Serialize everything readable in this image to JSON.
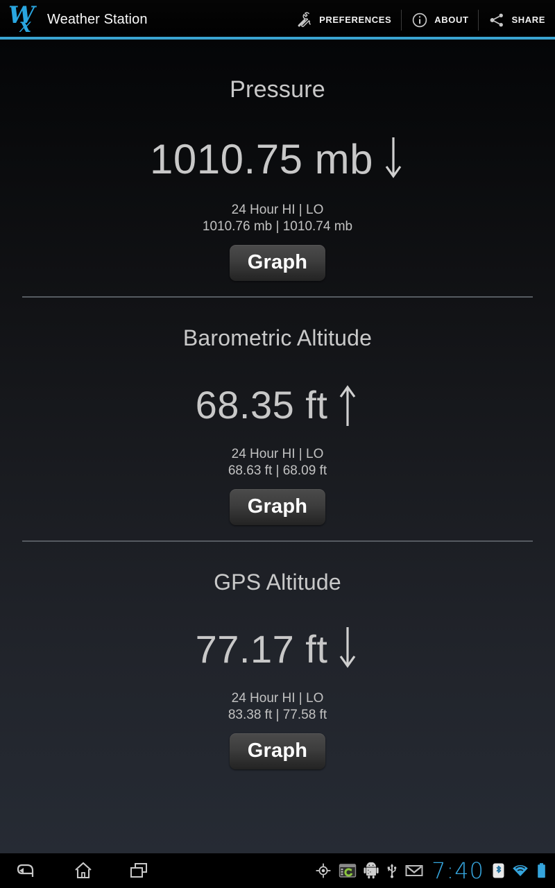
{
  "app": {
    "title": "Weather Station",
    "logo_icon": "wx-logo-icon",
    "accent_color": "#3aa3d0"
  },
  "actionbar": {
    "items": [
      {
        "label": "PREFERENCES",
        "icon": "wrench-icon"
      },
      {
        "label": "ABOUT",
        "icon": "info-circle-icon"
      },
      {
        "label": "SHARE",
        "icon": "share-icon"
      }
    ]
  },
  "sections": [
    {
      "title": "Pressure",
      "value": "1010.75 mb",
      "trend": "down",
      "trend_icon": "arrow-down-icon",
      "hilo_label": "24 Hour HI | LO",
      "hilo_values": "1010.76 mb | 1010.74 mb",
      "graph_label": "Graph"
    },
    {
      "title": "Barometric Altitude",
      "value": "68.35 ft",
      "trend": "up",
      "trend_icon": "arrow-up-icon",
      "hilo_label": "24 Hour HI | LO",
      "hilo_values": "68.63 ft | 68.09 ft",
      "graph_label": "Graph"
    },
    {
      "title": "GPS Altitude",
      "value": "77.17 ft",
      "trend": "down",
      "trend_icon": "arrow-down-icon",
      "hilo_label": "24 Hour HI | LO",
      "hilo_values": "83.38 ft | 77.58 ft",
      "graph_label": "Graph"
    }
  ],
  "navbar": {
    "buttons": [
      {
        "name": "back-icon"
      },
      {
        "name": "home-icon"
      },
      {
        "name": "recents-icon"
      }
    ],
    "status_icons": [
      "gps-location-icon",
      "sync-app-icon",
      "android-robot-icon",
      "usb-icon",
      "gmail-icon"
    ],
    "clock": "7:40",
    "right_icons": [
      "bluetooth-icon",
      "wifi-icon",
      "battery-full-icon"
    ],
    "clock_color": "#35a5dd"
  }
}
